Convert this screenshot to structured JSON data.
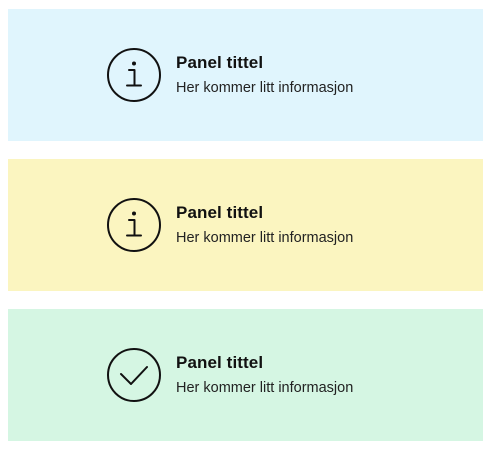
{
  "panels": [
    {
      "variant": "info",
      "icon": "info-icon",
      "title": "Panel tittel",
      "text": "Her kommer litt informasjon",
      "background": "#e0f5fd"
    },
    {
      "variant": "warning",
      "icon": "info-icon",
      "title": "Panel tittel",
      "text": "Her kommer litt informasjon",
      "background": "#fbf5c0"
    },
    {
      "variant": "success",
      "icon": "check-icon",
      "title": "Panel tittel",
      "text": "Her kommer litt informasjon",
      "background": "#d5f6e3"
    }
  ]
}
